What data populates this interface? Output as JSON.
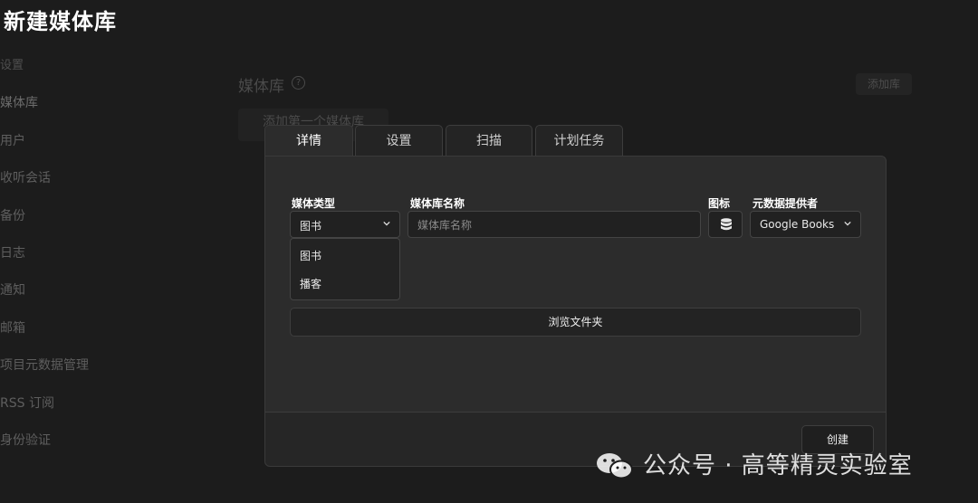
{
  "page_title": "新建媒体库",
  "sidebar": {
    "items": [
      {
        "label": "设置"
      },
      {
        "label": "媒体库"
      },
      {
        "label": "用户"
      },
      {
        "label": "收听会话"
      },
      {
        "label": "备份"
      },
      {
        "label": "日志"
      },
      {
        "label": "通知"
      },
      {
        "label": "邮箱"
      },
      {
        "label": "项目元数据管理"
      },
      {
        "label": "RSS 订阅"
      },
      {
        "label": "身份验证"
      }
    ]
  },
  "background": {
    "section_title": "媒体库",
    "help_icon": "question-circle-icon",
    "help_glyph": "?",
    "add_library_label": "添加库",
    "add_first_library_label": "添加第一个媒体库"
  },
  "dialog": {
    "tabs": [
      {
        "label": "详情",
        "active": true
      },
      {
        "label": "设置",
        "active": false
      },
      {
        "label": "扫描",
        "active": false
      },
      {
        "label": "计划任务",
        "active": false
      }
    ],
    "media_type": {
      "label": "媒体类型",
      "value": "图书",
      "options": [
        "图书",
        "播客"
      ]
    },
    "library_name": {
      "label": "媒体库名称",
      "placeholder": "媒体库名称",
      "value": ""
    },
    "icon": {
      "label": "图标",
      "icon_name": "database-icon"
    },
    "metadata_provider": {
      "label": "元数据提供者",
      "value": "Google Books"
    },
    "browse_label": "浏览文件夹",
    "create_label": "创建"
  },
  "watermark": {
    "text": "公众号 · 高等精灵实验室",
    "icon": "wechat-logo-icon"
  }
}
